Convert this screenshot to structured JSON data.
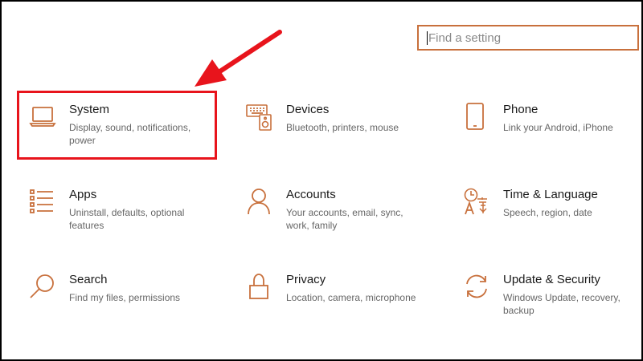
{
  "search": {
    "placeholder": "Find a setting"
  },
  "tiles": [
    {
      "title": "System",
      "description": "Display, sound, notifications, power",
      "icon": "laptop-icon"
    },
    {
      "title": "Devices",
      "description": "Bluetooth, printers, mouse",
      "icon": "keyboard-speaker-icon"
    },
    {
      "title": "Phone",
      "description": "Link your Android, iPhone",
      "icon": "phone-icon"
    },
    {
      "title": "Apps",
      "description": "Uninstall, defaults, optional features",
      "icon": "apps-list-icon"
    },
    {
      "title": "Accounts",
      "description": "Your accounts, email, sync, work, family",
      "icon": "person-icon"
    },
    {
      "title": "Time & Language",
      "description": "Speech, region, date",
      "icon": "time-language-icon"
    },
    {
      "title": "Search",
      "description": "Find my files, permissions",
      "icon": "magnifier-icon"
    },
    {
      "title": "Privacy",
      "description": "Location, camera, microphone",
      "icon": "lock-icon"
    },
    {
      "title": "Update & Security",
      "description": "Windows Update, recovery, backup",
      "icon": "sync-icon"
    }
  ],
  "colors": {
    "accent": "#c8703c",
    "annotation": "#e8141c"
  }
}
